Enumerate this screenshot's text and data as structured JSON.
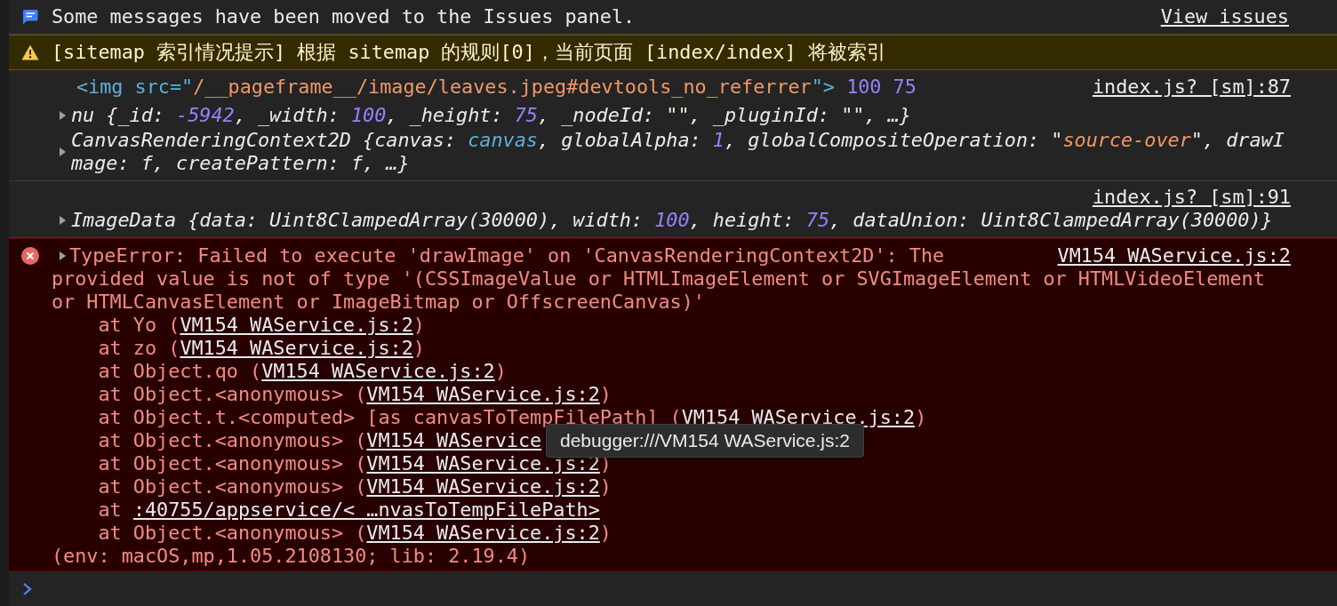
{
  "banner": {
    "message": "Some messages have been moved to the Issues panel.",
    "link": "View issues"
  },
  "warning": {
    "text": "[sitemap 索引情况提示] 根据 sitemap 的规则[0]，当前页面 [index/index] 将被索引"
  },
  "messages": [
    {
      "kind": "log",
      "source": "index.js? [sm]:87",
      "lines": [
        {
          "kind": "value",
          "tokens": [
            {
              "kind": "tag",
              "text": "<img src=\""
            },
            {
              "kind": "str",
              "text": "/__pageframe__/image/leaves.jpeg#devtools_no_referrer"
            },
            {
              "kind": "tag",
              "text": "\"> "
            },
            {
              "kind": "num",
              "text": "100 75"
            }
          ]
        },
        {
          "kind": "object",
          "expanded": false,
          "tokens": [
            {
              "kind": "obj",
              "text": "nu {_id: "
            },
            {
              "kind": "num",
              "text": "-5942"
            },
            {
              "kind": "obj",
              "text": ", _width: "
            },
            {
              "kind": "num",
              "text": "100"
            },
            {
              "kind": "obj",
              "text": ", _height: "
            },
            {
              "kind": "num",
              "text": "75"
            },
            {
              "kind": "obj",
              "text": ", _nodeId: \"\", _pluginId: \"\", …}"
            }
          ]
        },
        {
          "kind": "object",
          "expanded": false,
          "tokens": [
            {
              "kind": "obj",
              "text": "CanvasRenderingContext2D {canvas: "
            },
            {
              "kind": "node",
              "text": "canvas"
            },
            {
              "kind": "obj",
              "text": ", globalAlpha: "
            },
            {
              "kind": "num",
              "text": "1"
            },
            {
              "kind": "obj",
              "text": ", globalCompositeOperation: \""
            },
            {
              "kind": "str",
              "text": "source-over"
            },
            {
              "kind": "obj",
              "text": "\", drawImage: f, createPattern: f, …}"
            }
          ]
        }
      ]
    },
    {
      "kind": "log",
      "source": "index.js? [sm]:91",
      "lines": [
        {
          "kind": "object",
          "expanded": false,
          "tokens": [
            {
              "kind": "obj",
              "text": "ImageData {data: Uint8ClampedArray(30000), width: "
            },
            {
              "kind": "num",
              "text": "100"
            },
            {
              "kind": "obj",
              "text": ", height: "
            },
            {
              "kind": "num",
              "text": "75"
            },
            {
              "kind": "obj",
              "text": ", dataUnion: Uint8ClampedArray(30000)}"
            }
          ]
        }
      ]
    },
    {
      "kind": "error",
      "expanded": false,
      "source": "VM154 WAService.js:2",
      "text": "TypeError: Failed to execute 'drawImage' on 'CanvasRenderingContext2D': The",
      "text_continued": "provided value is not of type '(CSSImageValue or HTMLImageElement or SVGImageElement or HTMLVideoElement or HTMLCanvasElement or ImageBitmap or OffscreenCanvas)'",
      "frames": [
        {
          "text": "at Yo (",
          "link": "VM154 WAService.js:2",
          "after": ")"
        },
        {
          "text": "at zo (",
          "link": "VM154 WAService.js:2",
          "after": ")"
        },
        {
          "text": "at Object.qo (",
          "link": "VM154 WAService.js:2",
          "after": ")"
        },
        {
          "text": "at Object.<anonymous> (",
          "link": "VM154 WAService.js:2",
          "after": ")"
        },
        {
          "text": "at Object.t.<computed> [as canvasToTempFilePath] (",
          "link": "VM154 WAService.js:2",
          "after": ")"
        },
        {
          "text": "at Object.<anonymous> (",
          "link": "VM154 WAService"
        },
        {
          "text": "at Object.<anonymous> (",
          "link": "VM154 WAService.js:2",
          "after": ")"
        },
        {
          "text": "at Object.<anonymous> (",
          "link": "VM154 WAService.js:2",
          "after": ")"
        },
        {
          "text": "at ",
          "link": ":40755/appservice/< …nvasToTempFilePath>"
        },
        {
          "text": "at Object.<anonymous> (",
          "link": "VM154 WAService.js:2",
          "after": ")"
        }
      ],
      "footer": "(env: macOS,mp,1.05.2108130; lib: 2.19.4)"
    }
  ],
  "tooltip": {
    "text": "debugger:///VM154 WAService.js:2"
  }
}
